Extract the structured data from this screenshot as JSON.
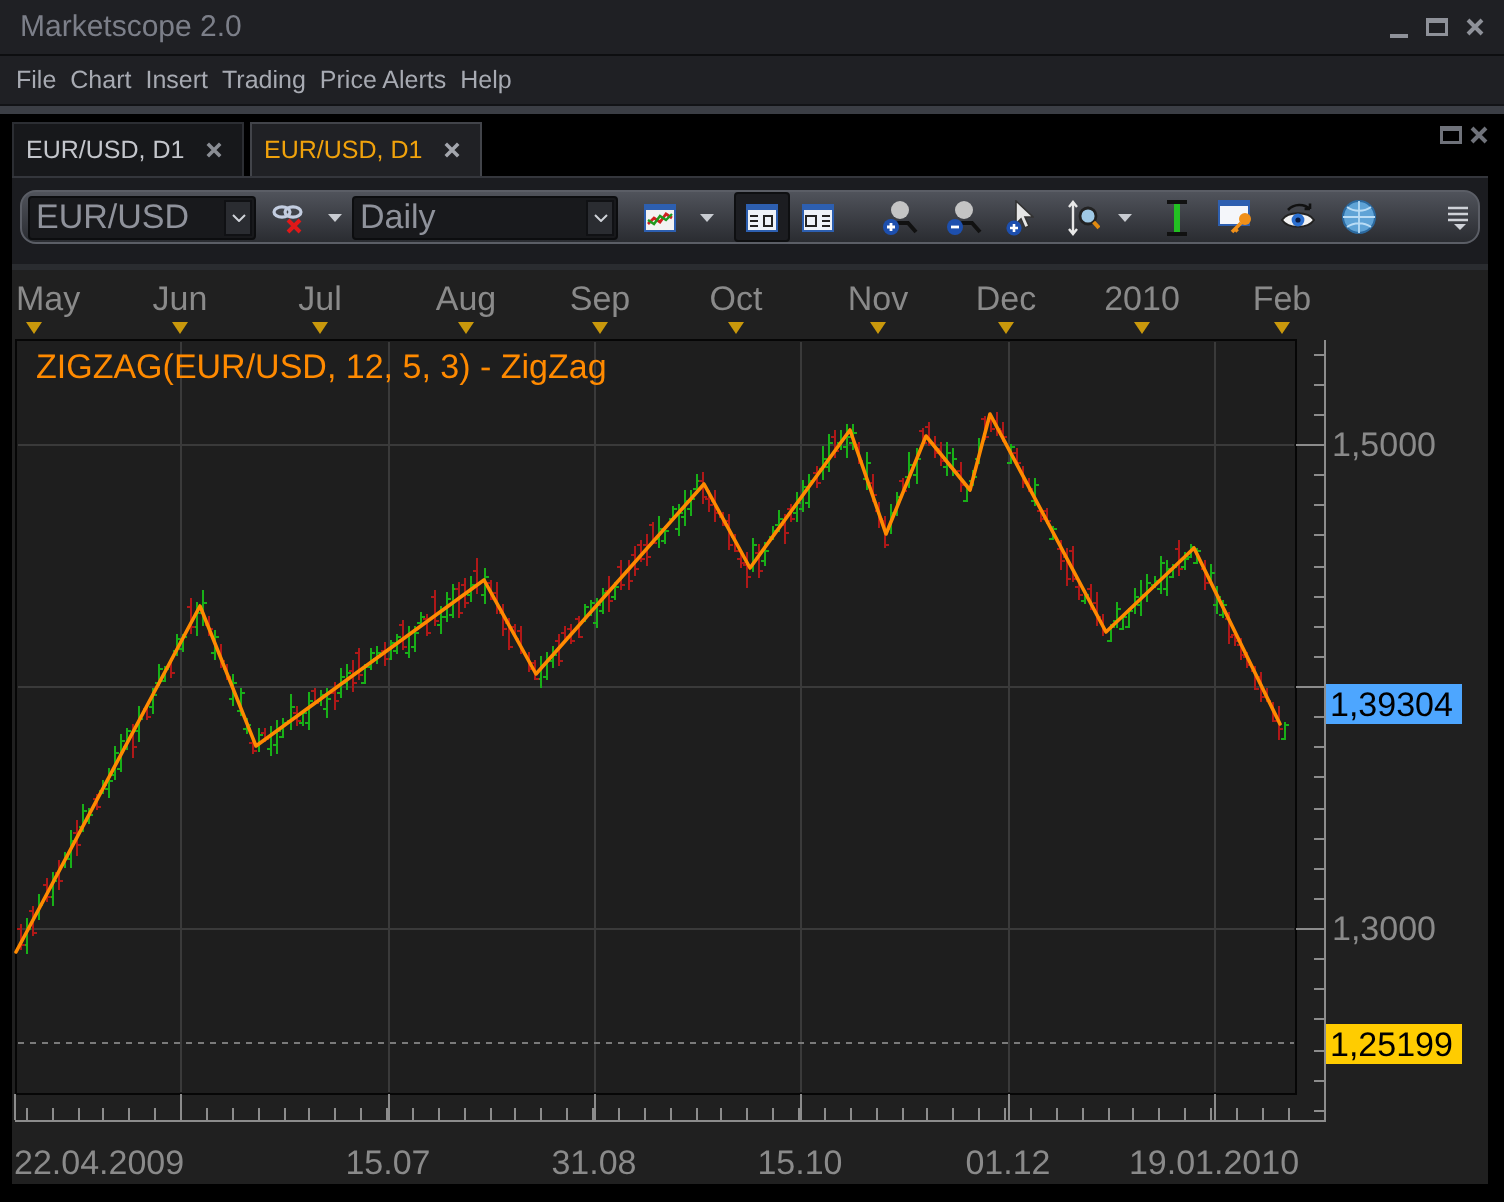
{
  "window": {
    "title": "Marketscope 2.0"
  },
  "menu": [
    "File",
    "Chart",
    "Insert",
    "Trading",
    "Price Alerts",
    "Help"
  ],
  "tabs": [
    {
      "label": "EUR/USD, D1",
      "selected": false
    },
    {
      "label": "EUR/USD, D1",
      "selected": true
    }
  ],
  "toolbar": {
    "symbol": {
      "value": "EUR/USD"
    },
    "period": {
      "value": "Daily"
    },
    "view_toggles": [
      {
        "selected": true
      },
      {
        "selected": false
      }
    ]
  },
  "chart": {
    "months": [
      "May",
      "Jun",
      "Jul",
      "Aug",
      "Sep",
      "Oct",
      "Nov",
      "Dec",
      "2010",
      "Feb"
    ],
    "legend": "ZIGZAG(EUR/USD, 12, 5, 3) - ZigZag",
    "price_labels": [
      "1,5000",
      "1,3000"
    ],
    "price_tags": [
      {
        "kind": "current",
        "label": "1,39304",
        "color": "#4da6ff"
      },
      {
        "kind": "level",
        "label": "1,25199",
        "color": "#ffcc00"
      }
    ],
    "dates": [
      "22.04.2009",
      "15.07",
      "31.08",
      "15.10",
      "01.12",
      "19.01.2010"
    ]
  }
}
